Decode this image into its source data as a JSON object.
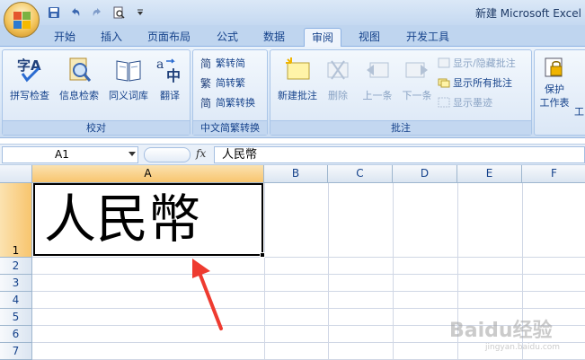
{
  "window": {
    "title": "新建 Microsoft Excel"
  },
  "quick_access": {
    "icons": [
      "save-icon",
      "undo-icon",
      "redo-icon",
      "print-preview-icon",
      "customize-icon"
    ]
  },
  "tabs": [
    {
      "label": "开始"
    },
    {
      "label": "插入"
    },
    {
      "label": "页面布局"
    },
    {
      "label": "公式"
    },
    {
      "label": "数据"
    },
    {
      "label": "审阅",
      "active": true
    },
    {
      "label": "视图"
    },
    {
      "label": "开发工具"
    }
  ],
  "ribbon": {
    "proofing": {
      "label": "校对",
      "spelling": "拼写检查",
      "research": "信息检索",
      "thesaurus": "同义词库",
      "translate": "翻译"
    },
    "chinese": {
      "label": "中文简繁转换",
      "to_simplified": "繁转简",
      "to_traditional": "简转繁",
      "convert": "简繁转换"
    },
    "comments": {
      "label": "批注",
      "new_comment": "新建批注",
      "delete": "删除",
      "previous": "上一条",
      "next": "下一条",
      "show_hide": "显示/隐藏批注",
      "show_all": "显示所有批注",
      "show_ink": "显示墨迹"
    },
    "changes": {
      "protect_sheet": "保护\n工作表",
      "protect_sheet_line1": "保护",
      "protect_sheet_line2": "工作表",
      "extra": "工"
    }
  },
  "formula_bar": {
    "name_box": "A1",
    "fx": "fx",
    "value": "人民幣"
  },
  "sheet": {
    "columns": [
      "A",
      "B",
      "C",
      "D",
      "E",
      "F"
    ],
    "rows": [
      "1",
      "2",
      "3",
      "4",
      "5",
      "6",
      "7"
    ],
    "selected_cell": "A1",
    "a1_value": "人民幣"
  },
  "annotation": {
    "color": "#ee3b30"
  },
  "watermark": {
    "main": "Baidu经验",
    "sub": "jingyan.baidu.com"
  }
}
